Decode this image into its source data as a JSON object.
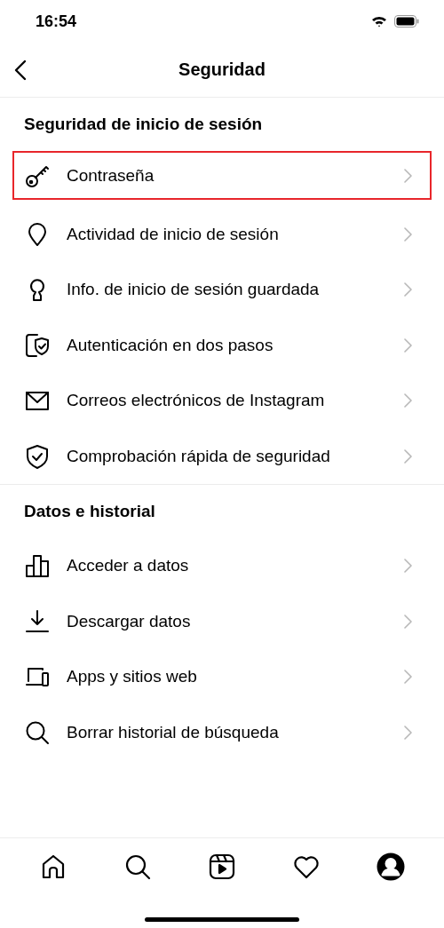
{
  "status_bar": {
    "time": "16:54"
  },
  "header": {
    "title": "Seguridad"
  },
  "sections": [
    {
      "title": "Seguridad de inicio de sesión",
      "items": [
        {
          "kind": "key",
          "label": "Contraseña",
          "highlighted": true
        },
        {
          "kind": "pin",
          "label": "Actividad de inicio de sesión",
          "highlighted": false
        },
        {
          "kind": "keyhole",
          "label": "Info. de inicio de sesión guardada",
          "highlighted": false
        },
        {
          "kind": "phone-shield",
          "label": "Autenticación en dos pasos",
          "highlighted": false
        },
        {
          "kind": "mail",
          "label": "Correos electrónicos de Instagram",
          "highlighted": false
        },
        {
          "kind": "shield",
          "label": "Comprobación rápida de seguridad",
          "highlighted": false
        }
      ]
    },
    {
      "title": "Datos e historial",
      "items": [
        {
          "kind": "bars",
          "label": "Acceder a datos",
          "highlighted": false
        },
        {
          "kind": "download",
          "label": "Descargar datos",
          "highlighted": false
        },
        {
          "kind": "devices",
          "label": "Apps y sitios web",
          "highlighted": false
        },
        {
          "kind": "search",
          "label": "Borrar historial de búsqueda",
          "highlighted": false
        }
      ]
    }
  ],
  "tab_bar": [
    {
      "kind": "home",
      "selected": false
    },
    {
      "kind": "search",
      "selected": false
    },
    {
      "kind": "reels",
      "selected": false
    },
    {
      "kind": "heart",
      "selected": false
    },
    {
      "kind": "profile",
      "selected": true
    }
  ]
}
